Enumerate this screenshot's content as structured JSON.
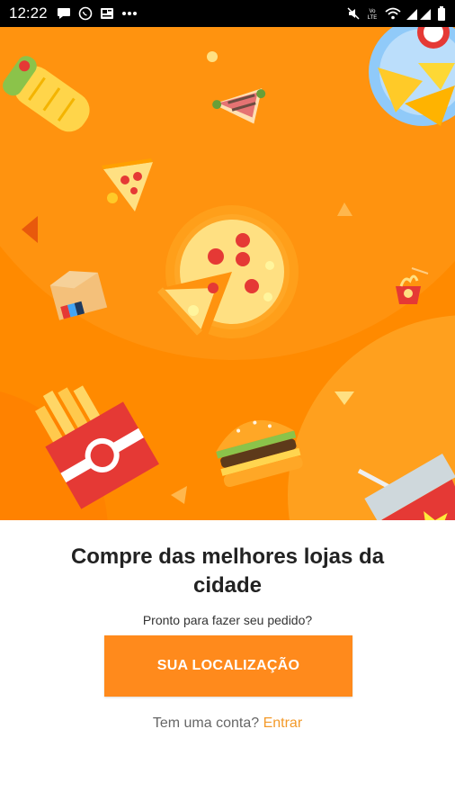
{
  "status_bar": {
    "time": "12:22",
    "left_icons": [
      "message-icon",
      "whatsapp-icon",
      "news-icon",
      "more-dots-icon"
    ],
    "right_icons": [
      "mute-icon",
      "volte-icon",
      "wifi-icon",
      "signal-icon",
      "battery-icon"
    ]
  },
  "hero": {
    "background_color": "#ff8a00",
    "illustrations": [
      "burrito-icon",
      "sandwich-icon",
      "nachos-plate-icon",
      "pizza-slice-icon",
      "pizza-icon",
      "noodles-box-icon",
      "food-box-icon",
      "fries-icon",
      "burger-icon",
      "soda-cup-icon"
    ]
  },
  "onboarding": {
    "headline": "Compre das melhores lojas da cidade",
    "subtitle": "Pronto para fazer seu pedido?",
    "cta_label": "SUA LOCALIZAÇÃO",
    "account_prompt": "Tem uma conta?",
    "login_link": "Entrar"
  },
  "colors": {
    "accent": "#ff8a1c",
    "link": "#f39a2a"
  }
}
